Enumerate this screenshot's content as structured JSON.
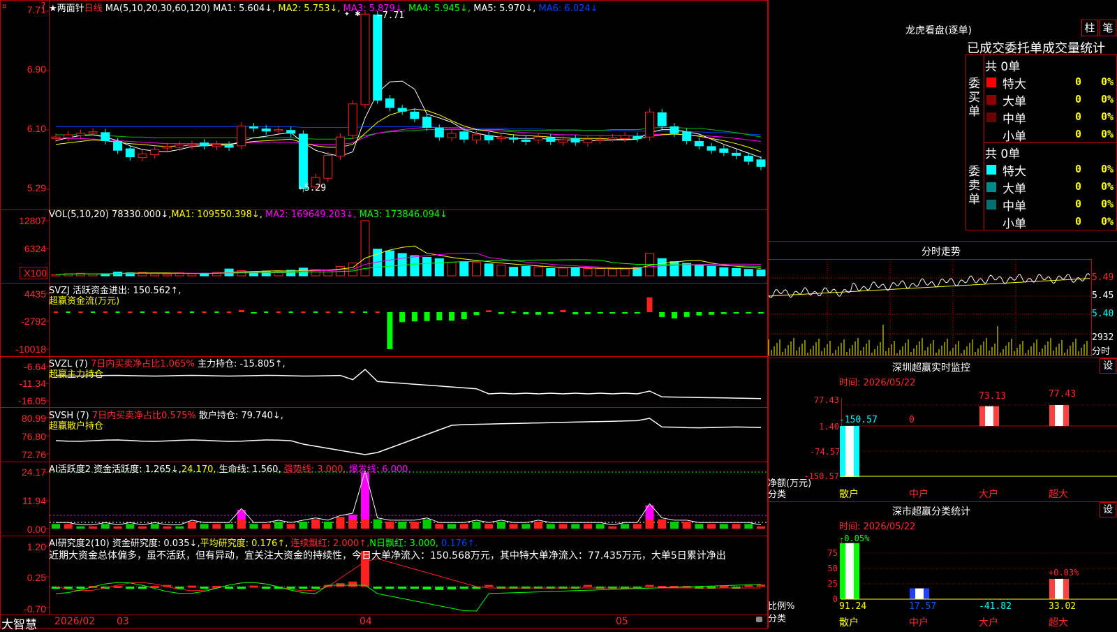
{
  "app": {
    "brand": "大智慧"
  },
  "header": {
    "stock_name": "★两面针",
    "period": "日线",
    "ma_params": "MA(5,10,20,30,60,120)",
    "ma": [
      {
        "label": "MA1: 5.604↓,",
        "color": "#ffffff"
      },
      {
        "label": "MA2: 5.753↓,",
        "color": "#ffff00"
      },
      {
        "label": "MA3: 5.879↓,",
        "color": "#ff00ff"
      },
      {
        "label": "MA4: 5.945↓,",
        "color": "#00ff00"
      },
      {
        "label": "MA5: 5.970↓,",
        "color": "#ffffff"
      },
      {
        "label": "MA6: 6.024↓",
        "color": "#0040ff"
      }
    ]
  },
  "price_panel": {
    "y_labels": [
      "7.71",
      "6.90",
      "6.10",
      "5.29"
    ],
    "high_annot": "7.71",
    "low_annot": "5.29",
    "closes": [
      6.0,
      6.03,
      6.05,
      6.07,
      5.95,
      5.82,
      5.73,
      5.77,
      5.83,
      5.87,
      5.89,
      5.9,
      5.88,
      5.9,
      5.86,
      6.15,
      6.12,
      6.08,
      6.1,
      6.05,
      5.3,
      5.45,
      5.75,
      6.0,
      6.45,
      7.67,
      6.5,
      6.4,
      6.35,
      6.25,
      6.13,
      6.0,
      6.05,
      5.97,
      6.03,
      5.96,
      6.0,
      5.97,
      5.94,
      6.0,
      5.94,
      5.96,
      5.93,
      5.97,
      5.97,
      5.99,
      6.02,
      5.98,
      6.34,
      6.15,
      6.05,
      5.95,
      5.88,
      5.82,
      5.79,
      5.75,
      5.67,
      5.6
    ],
    "ma1": [
      5.95,
      5.99,
      6.02,
      6.03,
      6.0,
      5.95,
      5.88,
      5.83,
      5.81,
      5.8,
      5.83,
      5.87,
      5.88,
      5.89,
      5.89,
      5.94,
      5.99,
      6.01,
      6.04,
      6.06,
      5.92,
      5.82,
      5.77,
      5.74,
      5.8,
      6.26,
      6.6,
      6.75,
      6.76,
      6.65,
      6.31,
      6.26,
      6.2,
      6.1,
      6.05,
      6.02,
      6.0,
      5.98,
      5.98,
      5.98,
      5.97,
      5.96,
      5.96,
      5.95,
      5.95,
      5.96,
      5.96,
      5.97,
      6.06,
      6.1,
      6.1,
      6.07,
      6.04,
      5.97,
      5.9,
      5.84,
      5.78,
      5.72
    ],
    "ma2": [
      5.9,
      5.92,
      5.94,
      5.96,
      5.95,
      5.93,
      5.91,
      5.9,
      5.88,
      5.87,
      5.88,
      5.89,
      5.89,
      5.9,
      5.9,
      5.92,
      5.94,
      5.95,
      5.96,
      5.97,
      5.92,
      5.88,
      5.86,
      5.86,
      5.9,
      6.05,
      6.2,
      6.3,
      6.35,
      6.38,
      6.36,
      6.3,
      6.22,
      6.15,
      6.1,
      6.08,
      6.05,
      6.03,
      6.02,
      6.01,
      6.0,
      5.99,
      5.98,
      5.98,
      5.98,
      5.97,
      5.97,
      5.97,
      6.01,
      6.03,
      6.04,
      6.03,
      6.01,
      5.98,
      5.95,
      5.91,
      5.86,
      5.8
    ],
    "ma3": [
      5.98,
      5.98,
      5.98,
      5.97,
      5.96,
      5.95,
      5.94,
      5.93,
      5.92,
      5.91,
      5.91,
      5.91,
      5.91,
      5.91,
      5.91,
      5.92,
      5.92,
      5.93,
      5.93,
      5.93,
      5.91,
      5.9,
      5.9,
      5.9,
      5.92,
      6.0,
      6.05,
      6.08,
      6.1,
      6.12,
      6.13,
      6.13,
      6.12,
      6.11,
      6.1,
      6.09,
      6.08,
      6.07,
      6.06,
      6.05,
      6.04,
      6.03,
      6.03,
      6.02,
      6.02,
      6.02,
      6.02,
      6.01,
      6.03,
      6.04,
      6.04,
      6.03,
      6.02,
      6.01,
      6.0,
      5.98,
      5.96,
      5.94
    ],
    "ma4": [
      6.03,
      6.03,
      6.03,
      6.03,
      6.02,
      6.01,
      6.0,
      6.0,
      5.99,
      5.99,
      5.99,
      5.99,
      5.99,
      5.99,
      5.99,
      5.99,
      5.99,
      5.99,
      5.99,
      5.99,
      5.98,
      5.97,
      5.97,
      5.97,
      5.98,
      6.02,
      6.05,
      6.07,
      6.08,
      6.09,
      6.1,
      6.1,
      6.1,
      6.1,
      6.1,
      6.1,
      6.1,
      6.09,
      6.09,
      6.09,
      6.09,
      6.09,
      6.09,
      6.09,
      6.09,
      6.1,
      6.1,
      6.1,
      6.12,
      6.13,
      6.13,
      6.12,
      6.12,
      6.1,
      6.08,
      6.06,
      6.03,
      6.0
    ],
    "ma6": [
      6.14,
      6.14,
      6.14,
      6.14,
      6.14,
      6.14,
      6.14,
      6.14,
      6.14,
      6.14,
      6.14,
      6.14,
      6.14,
      6.14,
      6.14,
      6.14,
      6.14,
      6.14,
      6.14,
      6.14,
      6.13,
      6.13,
      6.13,
      6.13,
      6.13,
      6.14,
      6.14,
      6.14,
      6.14,
      6.14,
      6.14,
      6.13,
      6.13,
      6.13,
      6.12,
      6.12,
      6.12,
      6.11,
      6.11,
      6.11,
      6.1,
      6.1,
      6.1,
      6.09,
      6.09,
      6.09,
      6.09,
      6.08,
      6.08,
      6.08,
      6.08,
      6.07,
      6.07,
      6.06,
      6.06,
      6.05,
      6.04,
      6.03
    ]
  },
  "vol_panel": {
    "title": "VOL(5,10,20)",
    "val": "78330.000↓,",
    "ma1": "MA1: 109550.398↓,",
    "ma2": "MA2: 169649.203↓,",
    "ma3": "MA3: 173846.094↓",
    "y_labels": [
      "12807",
      "6324",
      "X100"
    ],
    "vols": [
      300,
      500,
      600,
      400,
      500,
      900,
      700,
      800,
      500,
      400,
      700,
      500,
      600,
      800,
      1600,
      1200,
      900,
      1100,
      1000,
      1300,
      1800,
      1400,
      1200,
      2200,
      3000,
      12807,
      6200,
      5800,
      5200,
      4700,
      4300,
      4000,
      3200,
      3300,
      3100,
      2800,
      2500,
      2000,
      2200,
      2100,
      1700,
      1800,
      1900,
      1700,
      1700,
      1600,
      1600,
      2000,
      5200,
      4000,
      3300,
      2900,
      2500,
      2200,
      1900,
      1700,
      1500,
      1400
    ]
  },
  "svzj_panel": {
    "title": "SVZJ",
    "desc": "活跃资金进出: 150.562↑,",
    "sub": "超赢资金流(万元)",
    "y_labels": [
      "4435",
      "-2792",
      "-10018"
    ],
    "vals": [
      0,
      0,
      0,
      0,
      0,
      0,
      0,
      0,
      0,
      0,
      0,
      0,
      0,
      0,
      0,
      600,
      -300,
      0,
      0,
      0,
      0,
      0,
      0,
      0,
      0,
      0,
      0,
      -10000,
      -2700,
      -2500,
      -2400,
      -2200,
      -2300,
      -1900,
      -800,
      500,
      -500,
      0,
      -600,
      -700,
      -500,
      600,
      -600,
      -500,
      -300,
      -400,
      -400,
      -300,
      4000,
      -1300,
      -1700,
      -1300,
      -900,
      -700,
      -500,
      -400,
      -300,
      -200
    ]
  },
  "svzl_panel": {
    "title": "SVZL (7)",
    "ratio": "7日内买卖净占比1.065%",
    "hold": "主力持仓: -15.805↑,",
    "sub": "超赢主力持仓",
    "y_labels": [
      "-6.64",
      "-11.34",
      "-16.05"
    ]
  },
  "svsh_panel": {
    "title": "SVSH (7)",
    "ratio": "7日内买卖净占比0.575%",
    "hold": "散户持仓: 79.740↓,",
    "sub": "超赢散户持仓",
    "y_labels": [
      "80.99",
      "76.80",
      "72.76"
    ]
  },
  "ai_active_panel": {
    "title": "AI活跃度2",
    "active": "资金活跃度: 1.265↓,",
    "v1": "24.170,",
    "life": "生命线: 1.560,",
    "strong": "强势线: 3.000,",
    "burst": "爆发线: 6.000,",
    "y_labels": [
      "24.17",
      "11.94",
      "0.00"
    ]
  },
  "ai_research_panel": {
    "title": "AI研究度2(10)",
    "research": "资金研究度: 0.035↓,",
    "avg": "平均研究度: 0.176↑,",
    "cont": "连续飘红: 2.000↑,",
    "n": "N日飘红: 3.000,",
    "last": "0.176↑.",
    "comment": "近期大资金总体偏多，虽不活跃，但有异动，宜关注大资金的持续性，今日大单净流入：150.568万元，其中特大单净流入：77.435万元，大单5日累计净出",
    "y_labels": [
      "1.20",
      "0.25",
      "-0.70"
    ]
  },
  "x_axis": {
    "labels": [
      "2026/02",
      "03",
      "04",
      "05"
    ]
  },
  "lhb": {
    "title": "龙虎看盘(逐单)",
    "btn_zhu": "柱",
    "btn_bi": "笔",
    "subtitle": "已成交委托单成交量统计",
    "buy": {
      "side": "委买单",
      "total": "共 0单",
      "rows": [
        {
          "name": "特大",
          "count": "0",
          "pct": "0%",
          "color": "#ff0000"
        },
        {
          "name": "大单",
          "count": "0",
          "pct": "0%",
          "color": "#8b0000"
        },
        {
          "name": "中单",
          "count": "0",
          "pct": "0%",
          "color": "#6b0000"
        },
        {
          "name": "小单",
          "count": "0",
          "pct": "0%",
          "color": "#000000"
        }
      ]
    },
    "sell": {
      "side": "委卖单",
      "total": "共 0单",
      "rows": [
        {
          "name": "特大",
          "count": "0",
          "pct": "0%",
          "color": "#00ffff"
        },
        {
          "name": "大单",
          "count": "0",
          "pct": "0%",
          "color": "#008b8b"
        },
        {
          "name": "中单",
          "count": "0",
          "pct": "0%",
          "color": "#007070"
        },
        {
          "name": "小单",
          "count": "0",
          "pct": "0%",
          "color": "#000000"
        }
      ]
    }
  },
  "intraday": {
    "title": "分时走势",
    "y_labels": [
      "5.49",
      "5.45",
      "5.40"
    ],
    "vol_label": "2932",
    "vol_unit": "分时"
  },
  "sz_monitor": {
    "title": "深圳超赢实时监控",
    "btn": "设",
    "time": "时间: 2026/05/22",
    "y_labels": [
      "77.43",
      "1.40",
      "-74.57",
      "-150.57"
    ],
    "axis_title": "净额(万元)",
    "axis_sub": "分类",
    "categories": [
      "散户",
      "中户",
      "大户",
      "超大"
    ],
    "values": [
      -150.57,
      0,
      73.13,
      77.43
    ],
    "value_labels": [
      "-150.57",
      "0",
      "73.13",
      "77.43"
    ]
  },
  "sz_class": {
    "title": "深市超赢分类统计",
    "btn": "设",
    "time": "时间: 2026/05/22",
    "y_labels": [
      "75",
      "50",
      "25",
      "0"
    ],
    "axis_title": "比例%",
    "axis_sub": "分类",
    "categories": [
      "散户",
      "中户",
      "大户",
      "超大"
    ],
    "top_labels": [
      "-0.05%",
      "",
      "",
      "+0.03%"
    ],
    "bottom_labels": [
      "91.24",
      "17.57",
      "-41.82",
      "33.02"
    ],
    "heights": [
      91.24,
      17.57,
      0,
      33.02
    ]
  }
}
